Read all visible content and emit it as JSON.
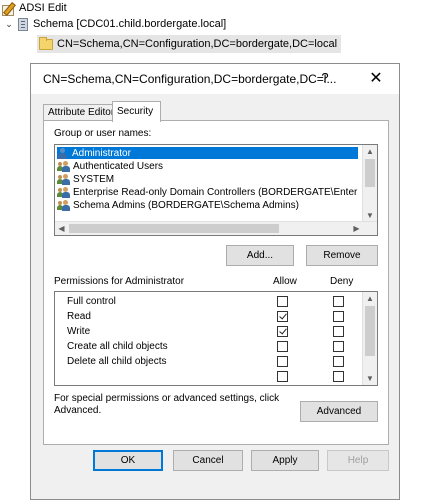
{
  "tree": {
    "root_label": "ADSI Edit",
    "schema_label": "Schema [CDC01.child.bordergate.local]",
    "node_label": "CN=Schema,CN=Configuration,DC=bordergate,DC=local"
  },
  "dialog": {
    "title": "CN=Schema,CN=Configuration,DC=bordergate,DC=l...",
    "help_glyph": "?",
    "close_glyph": "✕",
    "tabs": [
      {
        "label": "Attribute Editor",
        "active": false
      },
      {
        "label": "Security",
        "active": true
      }
    ],
    "group_label": "Group or user names:",
    "principals": [
      {
        "name": "Administrator",
        "icon": "user-icon",
        "selected": true
      },
      {
        "name": "Authenticated Users",
        "icon": "group-icon",
        "selected": false
      },
      {
        "name": "SYSTEM",
        "icon": "group-icon",
        "selected": false
      },
      {
        "name": "Enterprise Read-only Domain Controllers (BORDERGATE\\Enterprise",
        "icon": "group-icon",
        "selected": false
      },
      {
        "name": "Schema Admins (BORDERGATE\\Schema Admins)",
        "icon": "group-icon",
        "selected": false
      }
    ],
    "add_label": "Add...",
    "remove_label": "Remove",
    "permissions_for_label": "Permissions for Administrator",
    "allow_label": "Allow",
    "deny_label": "Deny",
    "permissions": [
      {
        "name": "Full control",
        "allow": false,
        "deny": false
      },
      {
        "name": "Read",
        "allow": true,
        "deny": false
      },
      {
        "name": "Write",
        "allow": true,
        "deny": false
      },
      {
        "name": "Create all child objects",
        "allow": false,
        "deny": false
      },
      {
        "name": "Delete all child objects",
        "allow": false,
        "deny": false
      }
    ],
    "special_note": "For special permissions or advanced settings, click Advanced.",
    "advanced_label": "Advanced",
    "ok_label": "OK",
    "cancel_label": "Cancel",
    "apply_label": "Apply",
    "help_label": "Help"
  },
  "colors": {
    "selection": "#0078d7",
    "dialog_bg": "#f0f0f0",
    "panel_bg": "#ffffff"
  }
}
